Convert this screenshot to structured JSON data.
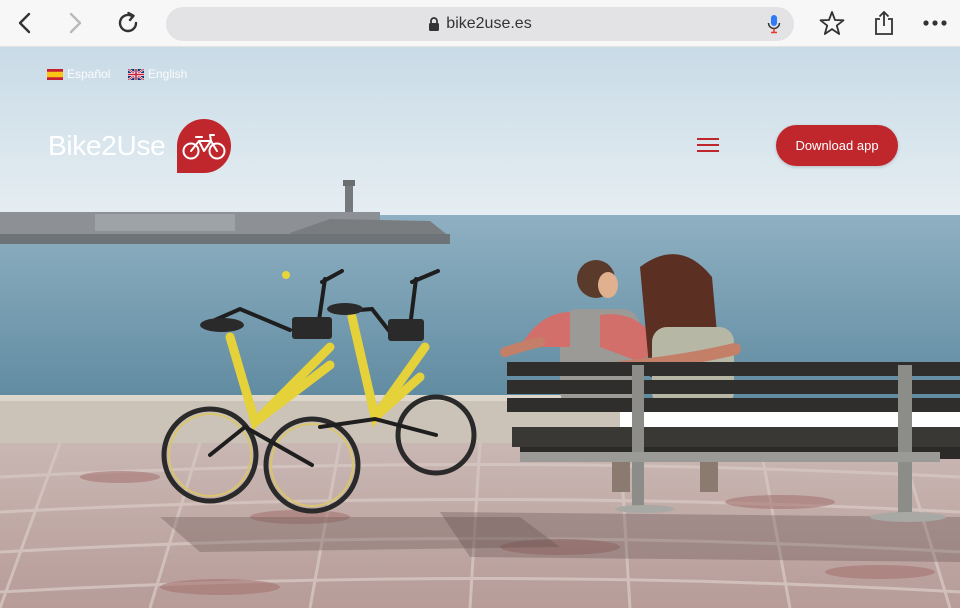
{
  "browser": {
    "url": "bike2use.es",
    "icons": [
      "back-icon",
      "forward-icon",
      "reload-icon",
      "lock-icon",
      "microphone-icon",
      "star-icon",
      "share-icon",
      "more-icon"
    ]
  },
  "site": {
    "languages": [
      {
        "label": "Español",
        "flag": "spain-flag-icon"
      },
      {
        "label": "English",
        "flag": "uk-flag-icon"
      }
    ],
    "brand_name": "Bike2Use",
    "menu_icon": "hamburger-menu-icon",
    "download_label": "Download app"
  },
  "colors": {
    "accent": "#c0272d",
    "sky": "#dbe7ee",
    "sea": "#6f98ad",
    "bike": "#e5d13a"
  }
}
